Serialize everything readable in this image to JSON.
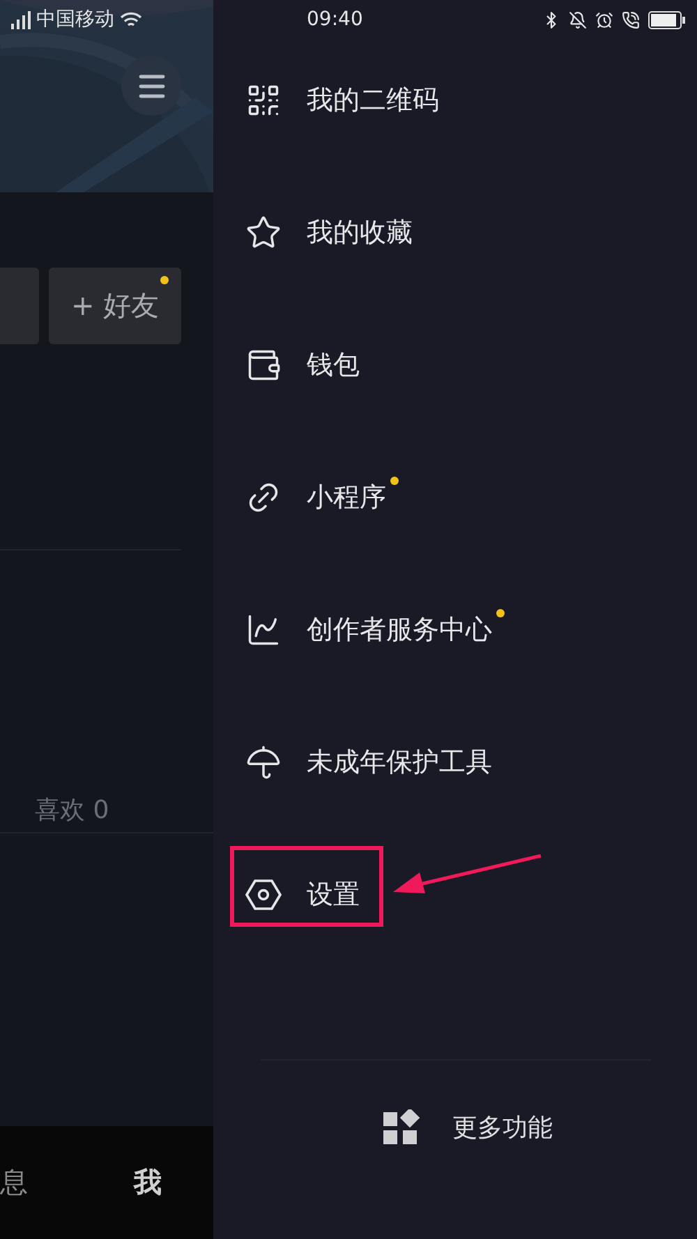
{
  "status_bar": {
    "carrier": "中国移动",
    "time": "09:40"
  },
  "profile": {
    "friend_button": {
      "label": "+ 好友",
      "dot": true
    },
    "likes": "喜欢 0"
  },
  "bottom_nav": [
    {
      "label": "息",
      "selected": false
    },
    {
      "label": "我",
      "selected": true
    }
  ],
  "drawer": {
    "items": [
      {
        "kind": "qr",
        "label": "我的二维码",
        "dot": false
      },
      {
        "kind": "star",
        "label": "我的收藏",
        "dot": false
      },
      {
        "kind": "wallet",
        "label": "钱包",
        "dot": false
      },
      {
        "kind": "link",
        "label": "小程序",
        "dot": true
      },
      {
        "kind": "chart",
        "label": "创作者服务中心",
        "dot": true
      },
      {
        "kind": "umbrella",
        "label": "未成年保护工具",
        "dot": false
      },
      {
        "kind": "settings",
        "label": "设置",
        "dot": false,
        "highlighted": true
      }
    ],
    "more": "更多功能"
  }
}
